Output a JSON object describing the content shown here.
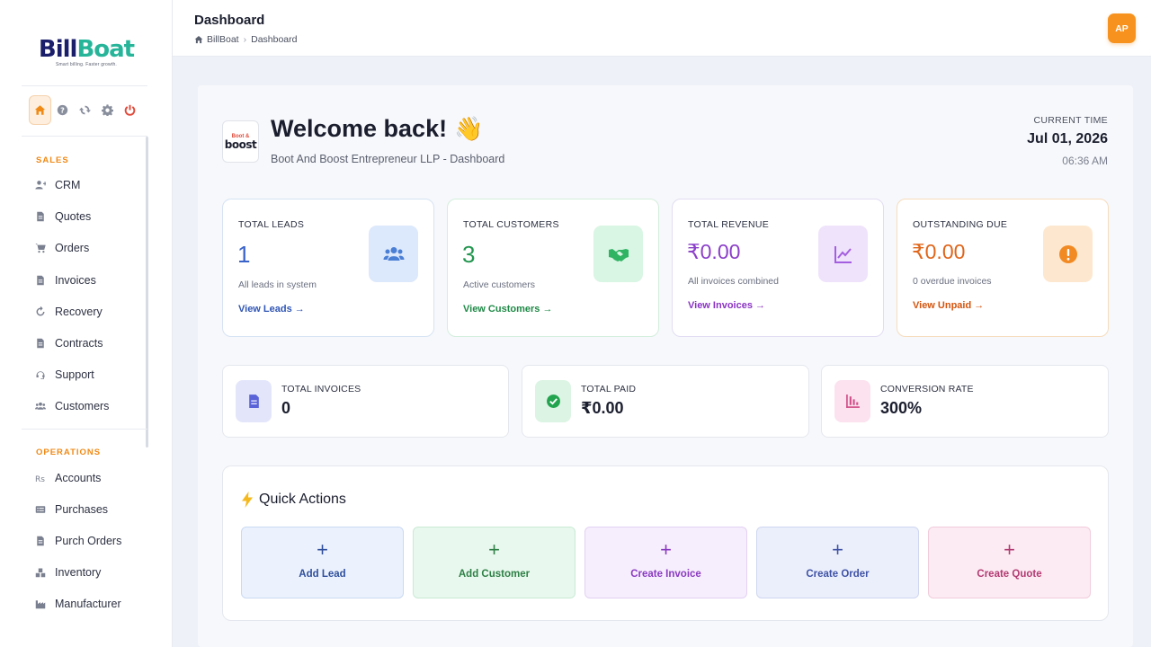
{
  "brand": {
    "name_part1": "Bill",
    "name_part2": "Boat",
    "tagline": "Smart billing. Faster growth."
  },
  "sidebar": {
    "sections": [
      {
        "label": "SALES",
        "items": [
          {
            "label": "CRM",
            "icon": "user-plus-icon"
          },
          {
            "label": "Quotes",
            "icon": "document-icon"
          },
          {
            "label": "Orders",
            "icon": "cart-icon"
          },
          {
            "label": "Invoices",
            "icon": "document-icon"
          },
          {
            "label": "Recovery",
            "icon": "refresh-icon"
          },
          {
            "label": "Contracts",
            "icon": "document-icon"
          },
          {
            "label": "Support",
            "icon": "headset-icon"
          },
          {
            "label": "Customers",
            "icon": "users-icon"
          }
        ]
      },
      {
        "label": "OPERATIONS",
        "items": [
          {
            "label": "Accounts",
            "icon": "rupee-icon"
          },
          {
            "label": "Purchases",
            "icon": "list-icon"
          },
          {
            "label": "Purch Orders",
            "icon": "document-icon"
          },
          {
            "label": "Inventory",
            "icon": "boxes-icon"
          },
          {
            "label": "Manufacturer",
            "icon": "factory-icon"
          }
        ]
      }
    ]
  },
  "header": {
    "title": "Dashboard",
    "breadcrumb": [
      "BillBoat",
      "Dashboard"
    ],
    "avatar_initials": "AP"
  },
  "welcome": {
    "company_logo_top": "Boot &",
    "company_logo_main": "boost",
    "greeting": "Welcome back!",
    "emoji": "👋",
    "subtitle": "Boot And Boost Entrepreneur LLP - Dashboard"
  },
  "time": {
    "label": "CURRENT TIME",
    "date": "Jul 01, 2026",
    "clock": "06:36 AM"
  },
  "stat_cards": [
    {
      "label": "TOTAL LEADS",
      "value": "1",
      "sub": "All leads in system",
      "link": "View Leads →",
      "color": "#3a63c9",
      "icon_bg": "#dce8fb",
      "border": "#d6e3f3"
    },
    {
      "label": "TOTAL CUSTOMERS",
      "value": "3",
      "sub": "Active customers",
      "link": "View Customers →",
      "color": "#23964f",
      "icon_bg": "#d9f5e3",
      "border": "#d3eedc"
    },
    {
      "label": "TOTAL REVENUE",
      "value": "₹0.00",
      "sub": "All invoices combined",
      "link": "View Invoices →",
      "color": "#8b3fc9",
      "icon_bg": "#efe3fb",
      "border": "#e2dcf3"
    },
    {
      "label": "OUTSTANDING DUE",
      "value": "₹0.00",
      "sub": "0 overdue invoices",
      "link": "View Unpaid →",
      "color": "#e0651a",
      "icon_bg": "#fde8cf",
      "border": "#f6dcbd"
    }
  ],
  "mini_cards": [
    {
      "label": "TOTAL INVOICES",
      "value": "0",
      "icon_bg": "#e3e6fb",
      "icon_color": "#5a63d8"
    },
    {
      "label": "TOTAL PAID",
      "value": "₹0.00",
      "icon_bg": "#dcf4e3",
      "icon_color": "#22a44f"
    },
    {
      "label": "CONVERSION RATE",
      "value": "300%",
      "icon_bg": "#fbe2ee",
      "icon_color": "#d2508a"
    }
  ],
  "quick_actions": {
    "title": "Quick Actions",
    "buttons": [
      {
        "label": "Add Lead",
        "bg": "#ecf2fd",
        "border": "#c9d9f2",
        "color": "#2f4f9c"
      },
      {
        "label": "Add Customer",
        "bg": "#e9f8ee",
        "border": "#c8ead4",
        "color": "#2d7f45"
      },
      {
        "label": "Create Invoice",
        "bg": "#f6eefc",
        "border": "#e2d1f3",
        "color": "#8a3ac2"
      },
      {
        "label": "Create Order",
        "bg": "#ebeffb",
        "border": "#cfd7f0",
        "color": "#3f52a6"
      },
      {
        "label": "Create Quote",
        "bg": "#fcebf2",
        "border": "#f1ccdc",
        "color": "#b23a72"
      }
    ]
  }
}
